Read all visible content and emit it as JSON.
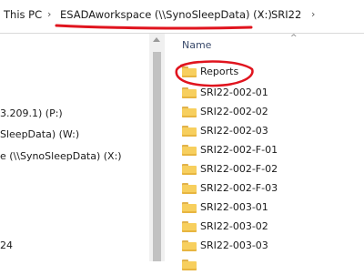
{
  "address_bar": {
    "items": [
      "This PC",
      "ESADAworkspace (\\\\SynoSleepData) (X:)",
      "SRI22"
    ]
  },
  "nav": {
    "items": [
      "3.209.1) (P:)",
      "SleepData) (W:)",
      "e (\\\\SynoSleepData) (X:)",
      "24"
    ]
  },
  "content": {
    "column_header": "Name",
    "folders": [
      "Reports",
      "SRI22-002-01",
      "SRI22-002-02",
      "SRI22-002-03",
      "SRI22-002-F-01",
      "SRI22-002-F-02",
      "SRI22-002-F-03",
      "SRI22-003-01",
      "SRI22-003-02",
      "SRI22-003-03"
    ]
  },
  "annotation_color": "#e0141e"
}
